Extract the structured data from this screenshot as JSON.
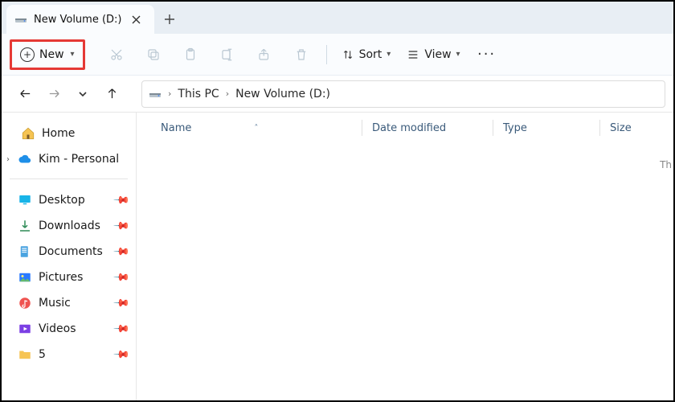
{
  "tab": {
    "title": "New Volume (D:)"
  },
  "toolbar": {
    "new_label": "New",
    "sort_label": "Sort",
    "view_label": "View"
  },
  "breadcrumb": {
    "root": "This PC",
    "current": "New Volume (D:)"
  },
  "sidebar": {
    "home": "Home",
    "cloud": "Kim - Personal",
    "quick": [
      {
        "label": "Desktop"
      },
      {
        "label": "Downloads"
      },
      {
        "label": "Documents"
      },
      {
        "label": "Pictures"
      },
      {
        "label": "Music"
      },
      {
        "label": "Videos"
      },
      {
        "label": "5"
      }
    ]
  },
  "columns": {
    "name": "Name",
    "date": "Date modified",
    "type": "Type",
    "size": "Size"
  },
  "edge_hint": "Th"
}
